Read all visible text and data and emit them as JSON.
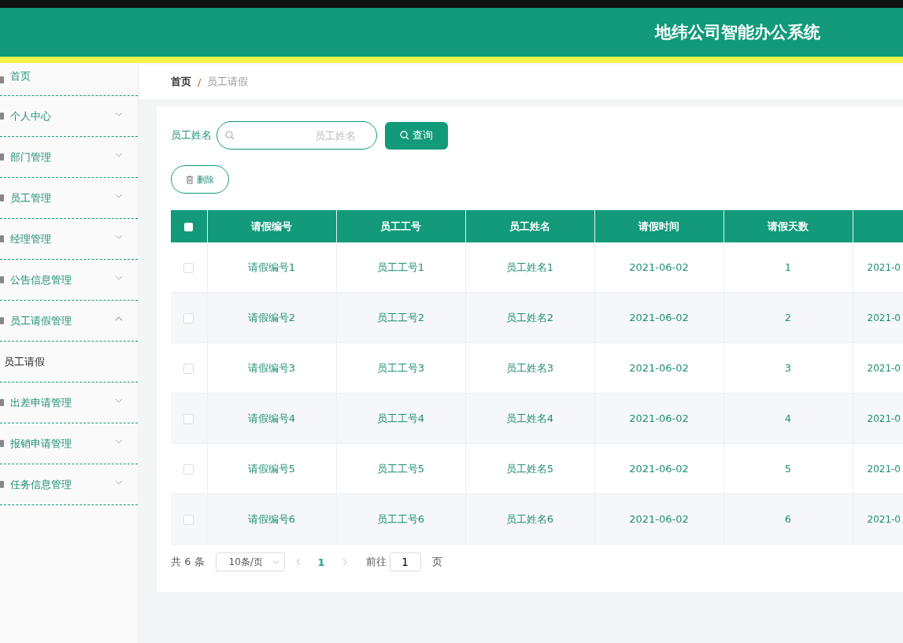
{
  "header": {
    "title": "地纬公司智能办公系统"
  },
  "sidebar": {
    "items": [
      {
        "label": "首页",
        "kind": "link"
      },
      {
        "label": "个人中心",
        "kind": "menu",
        "expanded": false
      },
      {
        "label": "部门管理",
        "kind": "menu",
        "expanded": false
      },
      {
        "label": "员工管理",
        "kind": "menu",
        "expanded": false
      },
      {
        "label": "经理管理",
        "kind": "menu",
        "expanded": false
      },
      {
        "label": "公告信息管理",
        "kind": "menu",
        "expanded": false
      },
      {
        "label": "员工请假管理",
        "kind": "menu",
        "expanded": true,
        "children": [
          {
            "label": "员工请假",
            "selected": true
          }
        ]
      },
      {
        "label": "出差申请管理",
        "kind": "menu",
        "expanded": false
      },
      {
        "label": "报销申请管理",
        "kind": "menu",
        "expanded": false
      },
      {
        "label": "任务信息管理",
        "kind": "menu",
        "expanded": false
      }
    ]
  },
  "breadcrumb": [
    "首页",
    "员工请假"
  ],
  "breadcrumb_separator": "/",
  "search": {
    "label": "员工姓名",
    "placeholder": "员工姓名",
    "button": "查询"
  },
  "delete_button": "删除",
  "table": {
    "all_checked": false,
    "columns": [
      "请假编号",
      "员工工号",
      "员工姓名",
      "请假时间",
      "请假天数"
    ],
    "rows": [
      {
        "checked": false,
        "cells": [
          "请假编号1",
          "员工工号1",
          "员工姓名1",
          "2021-06-02",
          "1",
          "2021-0"
        ]
      },
      {
        "checked": false,
        "cells": [
          "请假编号2",
          "员工工号2",
          "员工姓名2",
          "2021-06-02",
          "2",
          "2021-0"
        ]
      },
      {
        "checked": false,
        "cells": [
          "请假编号3",
          "员工工号3",
          "员工姓名3",
          "2021-06-02",
          "3",
          "2021-0"
        ]
      },
      {
        "checked": false,
        "cells": [
          "请假编号4",
          "员工工号4",
          "员工姓名4",
          "2021-06-02",
          "4",
          "2021-0"
        ]
      },
      {
        "checked": false,
        "cells": [
          "请假编号5",
          "员工工号5",
          "员工姓名5",
          "2021-06-02",
          "5",
          "2021-0"
        ]
      },
      {
        "checked": false,
        "cells": [
          "请假编号6",
          "员工工号6",
          "员工姓名6",
          "2021-06-02",
          "6",
          "2021-0"
        ]
      }
    ]
  },
  "pagination": {
    "total": "共 6 条",
    "page_size": "10条/页",
    "pages": [
      {
        "label": "1",
        "selected": true
      }
    ],
    "goto_label": "前往",
    "goto_value": "1",
    "goto_suffix": "页"
  }
}
